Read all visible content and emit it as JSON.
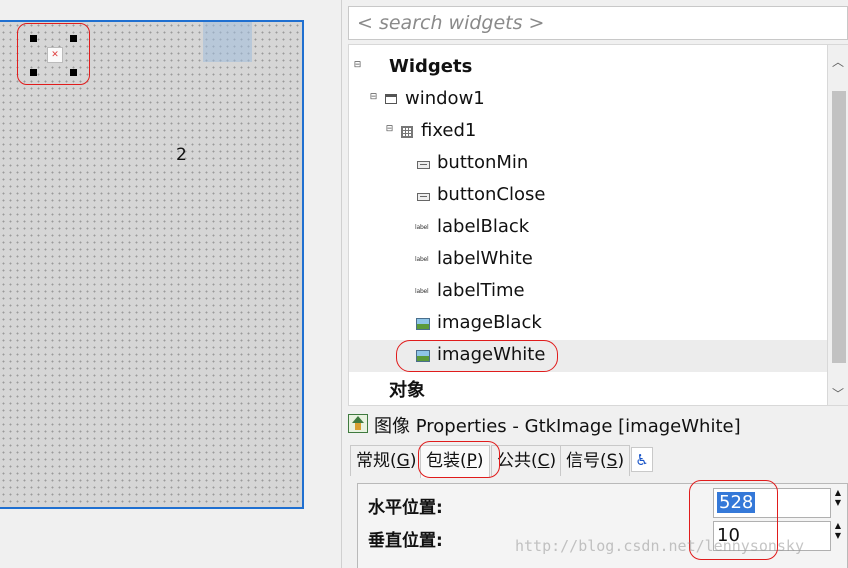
{
  "canvas": {
    "number_label": "2"
  },
  "search": {
    "placeholder": "< search widgets >"
  },
  "tree": {
    "rows": [
      {
        "label": "Widgets",
        "icon": "none",
        "expander": "⊟",
        "bold": true
      },
      {
        "label": "window1",
        "icon": "window-icon",
        "expander": "⊟"
      },
      {
        "label": "fixed1",
        "icon": "fixed-container-icon",
        "expander": "⊟"
      },
      {
        "label": "buttonMin",
        "icon": "button-widget-icon"
      },
      {
        "label": "buttonClose",
        "icon": "button-widget-icon"
      },
      {
        "label": "labelBlack",
        "icon": "label-widget-icon",
        "icon_text": "label"
      },
      {
        "label": "labelWhite",
        "icon": "label-widget-icon",
        "icon_text": "label"
      },
      {
        "label": "labelTime",
        "icon": "label-widget-icon",
        "icon_text": "label"
      },
      {
        "label": "imageBlack",
        "icon": "image-widget-icon"
      },
      {
        "label": "imageWhite",
        "icon": "image-widget-icon",
        "selected": true
      },
      {
        "label": "对象",
        "icon": "none",
        "bold": true
      }
    ]
  },
  "properties": {
    "title": "图像 Properties - GtkImage [imageWhite]",
    "tabs": [
      {
        "label": "常规",
        "mnemonic": "G"
      },
      {
        "label": "包装",
        "mnemonic": "P",
        "active": true
      },
      {
        "label": "公共",
        "mnemonic": "C"
      },
      {
        "label": "信号",
        "mnemonic": "S"
      }
    ],
    "accessibility_tab_icon": "accessibility-icon",
    "fields": [
      {
        "label": "水平位置:",
        "value": "528",
        "selected": true
      },
      {
        "label": "垂直位置:",
        "value": "10"
      }
    ]
  },
  "watermark": "http://blog.csdn.net/lennysonsky",
  "colors": {
    "canvas_border": "#1f6fd0",
    "annotation_red": "#e01c1c",
    "selection_blue": "#3478d8"
  }
}
